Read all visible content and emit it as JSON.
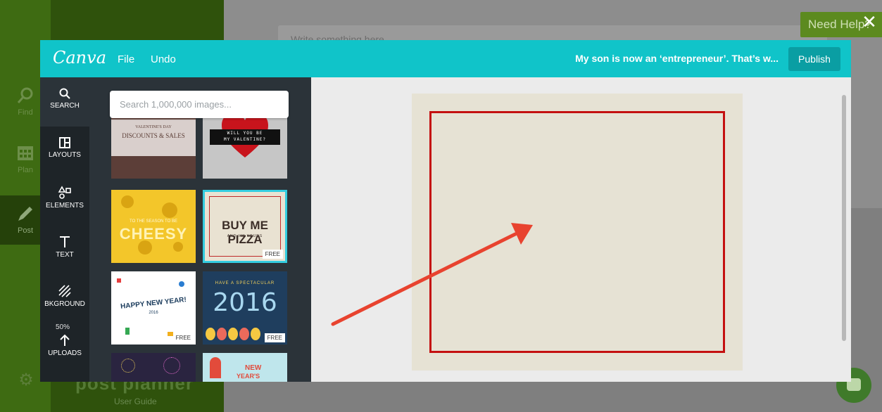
{
  "background_app": {
    "compose_placeholder": "Write something here",
    "nav": [
      {
        "label": "Find",
        "icon": "search-icon"
      },
      {
        "label": "Plan",
        "icon": "calendar-icon"
      },
      {
        "label": "Post",
        "icon": "pencil-icon"
      }
    ],
    "logo": "post planner",
    "user_guide": "User Guide",
    "need_help": "Need Help?"
  },
  "canva": {
    "logo": "Canva",
    "menu": {
      "file": "File",
      "undo": "Undo"
    },
    "doc_title": "My son is now an ‘entrepreneur’. That’s w...",
    "publish": "Publish",
    "toolbar": [
      {
        "label": "SEARCH",
        "icon": "search-icon"
      },
      {
        "label": "LAYOUTS",
        "icon": "layouts-icon"
      },
      {
        "label": "ELEMENTS",
        "icon": "elements-icon"
      },
      {
        "label": "TEXT",
        "icon": "text-icon"
      },
      {
        "label": "BKGROUND",
        "icon": "background-icon"
      },
      {
        "label": "UPLOADS",
        "icon": "upload-icon"
      }
    ],
    "search_placeholder": "Search 1,000,000 images...",
    "templates": [
      {
        "name": "valentines-discounts",
        "lines": [
          "VALENTINE'S DAY",
          "DISCOUNTS & SALES"
        ]
      },
      {
        "name": "will-you-be-my-valentine",
        "lines": [
          "WILL YOU BE",
          "MY VALENTINE?"
        ]
      },
      {
        "name": "cheesy",
        "lines": [
          "TO THE SEASON TO BE",
          "CHEESY"
        ]
      },
      {
        "name": "buy-me-pizza",
        "lines": [
          "BUY ME PIZZA",
          "AND I'M YOURS"
        ],
        "free": "FREE"
      },
      {
        "name": "happy-new-year",
        "lines": [
          "HAPPY NEW YEAR!",
          "2016"
        ],
        "free": "FREE"
      },
      {
        "name": "spectacular-2016",
        "lines": [
          "HAVE A SPECTACULAR",
          "2016"
        ],
        "free": "FREE"
      },
      {
        "name": "fireworks",
        "lines": []
      },
      {
        "name": "new-years",
        "lines": [
          "NEW",
          "YEAR'S"
        ]
      }
    ],
    "overlay_texts": [
      "50%"
    ]
  },
  "colors": {
    "canva_teal": "#10c4c9",
    "publish_teal": "#0a9ea3",
    "frame_red": "#c41010",
    "arrow_red": "#e8432f"
  }
}
